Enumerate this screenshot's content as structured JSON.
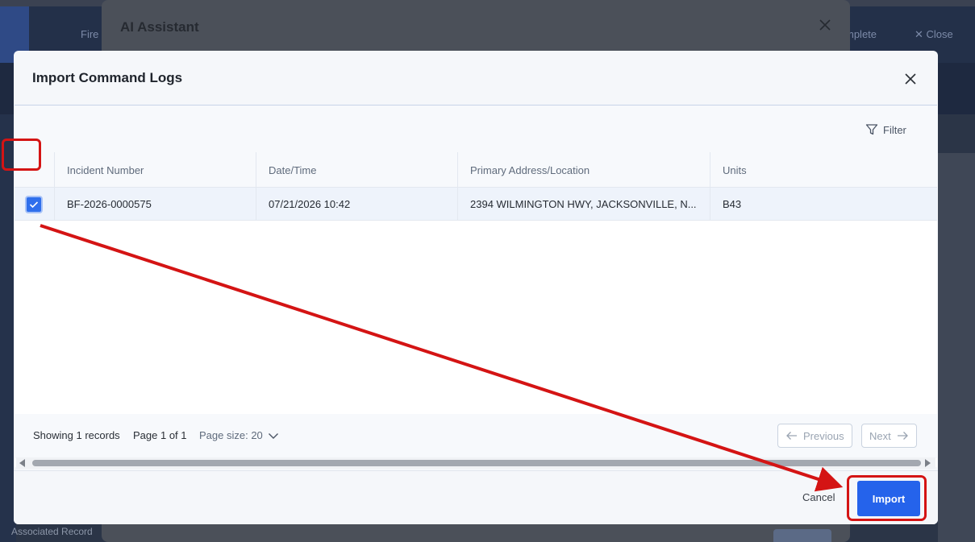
{
  "background": {
    "header_items": {
      "fire": "Fire",
      "complete": "mplete",
      "close": "Close"
    },
    "sidebar_footer": "Associated Record"
  },
  "ai_dialog": {
    "title": "AI Assistant"
  },
  "modal": {
    "title": "Import Command Logs",
    "toolbar": {
      "filter_label": "Filter"
    },
    "table": {
      "columns": [
        "Incident Number",
        "Date/Time",
        "Primary Address/Location",
        "Units"
      ],
      "rows": [
        {
          "selected": true,
          "incident_number": "BF-2026-0000575",
          "date_time": "07/21/2026 10:42",
          "address": "2394 WILMINGTON HWY, JACKSONVILLE, N...",
          "units": "B43"
        }
      ]
    },
    "pager": {
      "showing": "Showing 1 records",
      "page": "Page 1 of 1",
      "page_size": "Page size: 20",
      "previous": "Previous",
      "next": "Next"
    },
    "footer": {
      "cancel": "Cancel",
      "import": "Import"
    }
  },
  "colors": {
    "accent": "#2563eb",
    "annotation": "#d41414"
  }
}
